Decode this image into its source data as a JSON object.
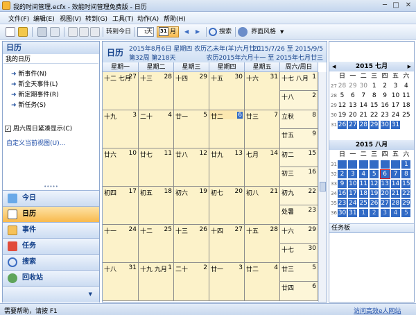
{
  "window": {
    "title": "我的时间管理.ecfx - 效能时间管理免费版 - 日历",
    "minimize": "─",
    "maximize": "□",
    "close": "✕"
  },
  "menu": [
    "文件(F)",
    "编辑(E)",
    "视图(V)",
    "转到(G)",
    "工具(T)",
    "动作(A)",
    "帮助(H)"
  ],
  "toolbar": {
    "today": "转到今日",
    "day": "天",
    "day_icon": "1",
    "month": "月",
    "month_icon": "31",
    "search": "搜索",
    "theme": "界面风格"
  },
  "left": {
    "title": "日历",
    "section": "我的日历",
    "actions": [
      "新事件(N)",
      "新全天事件(L)",
      "新定期事件(R)",
      "新任务(S)"
    ],
    "compress_weekend": "周六周日紧凑显示(C)",
    "custom_view": "自定义当前视图(U)...",
    "nav": [
      {
        "label": "今日",
        "icon": "today-icon"
      },
      {
        "label": "日历",
        "icon": "calendar-icon"
      },
      {
        "label": "事件",
        "icon": "event-icon"
      },
      {
        "label": "任务",
        "icon": "task-icon"
      },
      {
        "label": "搜索",
        "icon": "search-icon"
      },
      {
        "label": "回收站",
        "icon": "recycle-icon"
      }
    ]
  },
  "main": {
    "title": "日历",
    "date_line": "2015年8月6日 星期四 农历乙未年(羊)六月廿二",
    "week_line": "第32周 第218天",
    "range": "2015/7/26 至 2015/9/5",
    "lunar_range": "农历2015年六月十一 至 2015年七月廿三",
    "weekdays": [
      "星期一",
      "星期二",
      "星期三",
      "星期四",
      "星期五",
      "六/日"
    ],
    "weekend_header": "周六/周日",
    "weeks": [
      {
        "days": [
          {
            "l": "十二 七月",
            "r": "27"
          },
          {
            "l": "十三",
            "r": "28"
          },
          {
            "l": "十四",
            "r": "29"
          },
          {
            "l": "十五",
            "r": "30"
          },
          {
            "l": "十六",
            "r": "31"
          }
        ],
        "sat": {
          "l": "十七 八月",
          "r": "1"
        },
        "sun": {
          "l": "十八",
          "r": "2"
        }
      },
      {
        "days": [
          {
            "l": "十九",
            "r": "3"
          },
          {
            "l": "二十",
            "r": "4"
          },
          {
            "l": "廿一",
            "r": "5"
          },
          {
            "l": "廿二",
            "r": "6",
            "today": true
          },
          {
            "l": "廿三",
            "r": "7"
          }
        ],
        "sat": {
          "l": "立秋",
          "r": "8"
        },
        "sun": {
          "l": "廿五",
          "r": "9"
        }
      },
      {
        "days": [
          {
            "l": "廿六",
            "r": "10"
          },
          {
            "l": "廿七",
            "r": "11"
          },
          {
            "l": "廿八",
            "r": "12"
          },
          {
            "l": "廿九",
            "r": "13"
          },
          {
            "l": "七月",
            "r": "14"
          }
        ],
        "sat": {
          "l": "初二",
          "r": "15"
        },
        "sun": {
          "l": "初三",
          "r": "16"
        }
      },
      {
        "days": [
          {
            "l": "初四",
            "r": "17"
          },
          {
            "l": "初五",
            "r": "18"
          },
          {
            "l": "初六",
            "r": "19"
          },
          {
            "l": "初七",
            "r": "20"
          },
          {
            "l": "初八",
            "r": "21"
          }
        ],
        "sat": {
          "l": "初九",
          "r": "22"
        },
        "sun": {
          "l": "处暑",
          "r": "23"
        }
      },
      {
        "days": [
          {
            "l": "十一",
            "r": "24"
          },
          {
            "l": "十二",
            "r": "25"
          },
          {
            "l": "十三",
            "r": "26"
          },
          {
            "l": "十四",
            "r": "27"
          },
          {
            "l": "十五",
            "r": "28"
          }
        ],
        "sat": {
          "l": "十六",
          "r": "29"
        },
        "sun": {
          "l": "十七",
          "r": "30"
        }
      },
      {
        "days": [
          {
            "l": "十八",
            "r": "31"
          },
          {
            "l": "十九 九月",
            "r": "1"
          },
          {
            "l": "二十",
            "r": "2"
          },
          {
            "l": "廿一",
            "r": "3"
          },
          {
            "l": "廿二",
            "r": "4"
          }
        ],
        "sat": {
          "l": "廿三",
          "r": "5"
        },
        "sun": {
          "l": "廿四",
          "r": "6"
        }
      }
    ]
  },
  "mini": {
    "dow": [
      "日",
      "一",
      "二",
      "三",
      "四",
      "五",
      "六"
    ],
    "prev": "◀",
    "next": "▶",
    "july": {
      "title": "2015 七月",
      "rows": [
        {
          "wk": "27",
          "days": [
            {
              "d": "28",
              "other": true
            },
            {
              "d": "29",
              "other": true
            },
            {
              "d": "30",
              "other": true
            },
            {
              "d": "1"
            },
            {
              "d": "2"
            },
            {
              "d": "3"
            },
            {
              "d": "4"
            }
          ]
        },
        {
          "wk": "28",
          "days": [
            {
              "d": "5"
            },
            {
              "d": "6"
            },
            {
              "d": "7"
            },
            {
              "d": "8"
            },
            {
              "d": "9"
            },
            {
              "d": "10"
            },
            {
              "d": "11"
            }
          ]
        },
        {
          "wk": "29",
          "days": [
            {
              "d": "12"
            },
            {
              "d": "13"
            },
            {
              "d": "14"
            },
            {
              "d": "15"
            },
            {
              "d": "16"
            },
            {
              "d": "17"
            },
            {
              "d": "18"
            }
          ]
        },
        {
          "wk": "30",
          "days": [
            {
              "d": "19"
            },
            {
              "d": "20"
            },
            {
              "d": "21"
            },
            {
              "d": "22"
            },
            {
              "d": "23"
            },
            {
              "d": "24"
            },
            {
              "d": "25"
            }
          ]
        },
        {
          "wk": "31",
          "days": [
            {
              "d": "26",
              "sel": true
            },
            {
              "d": "27",
              "sel": true
            },
            {
              "d": "28",
              "sel": true
            },
            {
              "d": "29",
              "sel": true
            },
            {
              "d": "30",
              "sel": true
            },
            {
              "d": "31",
              "sel": true
            },
            {
              "d": ""
            }
          ]
        }
      ]
    },
    "aug": {
      "title": "2015 八月",
      "rows": [
        {
          "wk": "31",
          "days": [
            {
              "d": "",
              "sel": true
            },
            {
              "d": "",
              "sel": true
            },
            {
              "d": "",
              "sel": true
            },
            {
              "d": "",
              "sel": true
            },
            {
              "d": "",
              "sel": true
            },
            {
              "d": "",
              "sel": true
            },
            {
              "d": "1",
              "sel": true
            }
          ]
        },
        {
          "wk": "32",
          "days": [
            {
              "d": "2",
              "sel": true
            },
            {
              "d": "3",
              "sel": true
            },
            {
              "d": "4",
              "sel": true
            },
            {
              "d": "5",
              "sel": true
            },
            {
              "d": "6",
              "sel": true,
              "today": true
            },
            {
              "d": "7",
              "sel": true
            },
            {
              "d": "8",
              "sel": true
            }
          ]
        },
        {
          "wk": "33",
          "days": [
            {
              "d": "9",
              "sel": true
            },
            {
              "d": "10",
              "sel": true
            },
            {
              "d": "11",
              "sel": true
            },
            {
              "d": "12",
              "sel": true
            },
            {
              "d": "13",
              "sel": true
            },
            {
              "d": "14",
              "sel": true
            },
            {
              "d": "15",
              "sel": true
            }
          ]
        },
        {
          "wk": "34",
          "days": [
            {
              "d": "16",
              "sel": true
            },
            {
              "d": "17",
              "sel": true
            },
            {
              "d": "18",
              "sel": true
            },
            {
              "d": "19",
              "sel": true
            },
            {
              "d": "20",
              "sel": true
            },
            {
              "d": "21",
              "sel": true
            },
            {
              "d": "22",
              "sel": true
            }
          ]
        },
        {
          "wk": "35",
          "days": [
            {
              "d": "23",
              "sel": true
            },
            {
              "d": "24",
              "sel": true
            },
            {
              "d": "25",
              "sel": true
            },
            {
              "d": "26",
              "sel": true
            },
            {
              "d": "27",
              "sel": true
            },
            {
              "d": "28",
              "sel": true
            },
            {
              "d": "29",
              "sel": true
            }
          ]
        },
        {
          "wk": "36",
          "days": [
            {
              "d": "30",
              "sel": true
            },
            {
              "d": "31",
              "sel": true
            },
            {
              "d": "1",
              "sel": true,
              "other": true
            },
            {
              "d": "2",
              "sel": true,
              "other": true
            },
            {
              "d": "3",
              "sel": true,
              "other": true
            },
            {
              "d": "4",
              "sel": true,
              "other": true
            },
            {
              "d": "5",
              "sel": true,
              "other": true
            }
          ]
        }
      ]
    },
    "taskpad": "任务板"
  },
  "status": {
    "help": "需要帮助，请按 F1",
    "link": "访问高效e人网站"
  },
  "colors": {
    "selection": "#316ac5",
    "cell": "#fcf2c9",
    "today": "#fce8b0",
    "nav_selected": "#f8b94d",
    "accent": "#15428b"
  }
}
